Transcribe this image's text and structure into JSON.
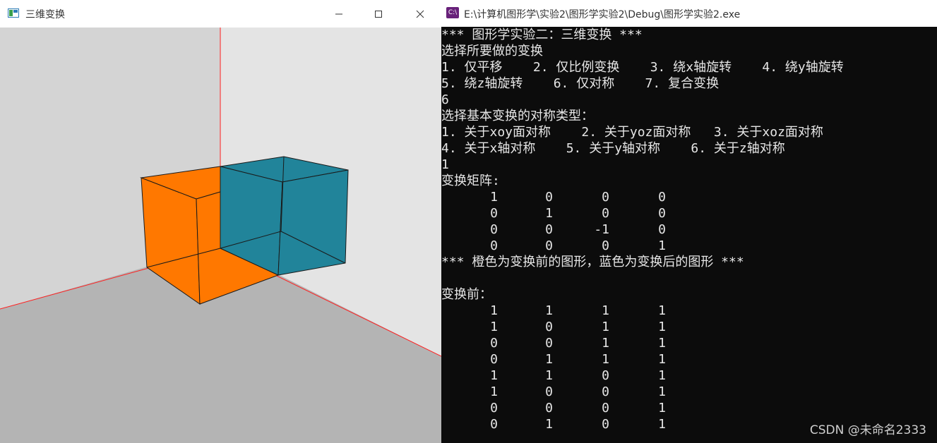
{
  "left_window": {
    "title": "三维变换",
    "colors": {
      "wall_back": "#e4e4e4",
      "wall_left": "#d4d4d4",
      "floor": "#b4b4b4",
      "axis": "#ff2020",
      "cube_before": "#ff7800",
      "cube_after": "#21849a",
      "edge": "#1a1a1a"
    },
    "controls": {
      "minimize": "minimize-icon",
      "maximize": "maximize-icon",
      "close": "close-icon"
    }
  },
  "right_window": {
    "title": "E:\\计算机图形学\\实验2\\图形学实验2\\Debug\\图形学实验2.exe",
    "icon_text": "C:\\",
    "lines": [
      "*** 图形学实验二：三维变换 ***",
      "选择所要做的变换",
      "1. 仅平移    2. 仅比例变换    3. 绕x轴旋转    4. 绕y轴旋转",
      "5. 绕z轴旋转    6. 仅对称    7. 复合变换",
      "6",
      "选择基本变换的对称类型：",
      "1. 关于xoy面对称    2. 关于yoz面对称   3. 关于xoz面对称",
      "4. 关于x轴对称    5. 关于y轴对称    6. 关于z轴对称",
      "1",
      "变换矩阵:"
    ],
    "matrix": [
      [
        "1",
        "0",
        "0",
        "0"
      ],
      [
        "0",
        "1",
        "0",
        "0"
      ],
      [
        "0",
        "0",
        "-1",
        "0"
      ],
      [
        "0",
        "0",
        "0",
        "1"
      ]
    ],
    "note_line": "*** 橙色为变换前的图形，蓝色为变换后的图形 ***",
    "before_label": "变换前：",
    "before_matrix": [
      [
        "1",
        "1",
        "1",
        "1"
      ],
      [
        "1",
        "0",
        "1",
        "1"
      ],
      [
        "0",
        "0",
        "1",
        "1"
      ],
      [
        "0",
        "1",
        "1",
        "1"
      ],
      [
        "1",
        "1",
        "0",
        "1"
      ],
      [
        "1",
        "0",
        "0",
        "1"
      ],
      [
        "0",
        "0",
        "0",
        "1"
      ],
      [
        "0",
        "1",
        "0",
        "1"
      ]
    ],
    "watermark": "CSDN @未命名2333"
  }
}
